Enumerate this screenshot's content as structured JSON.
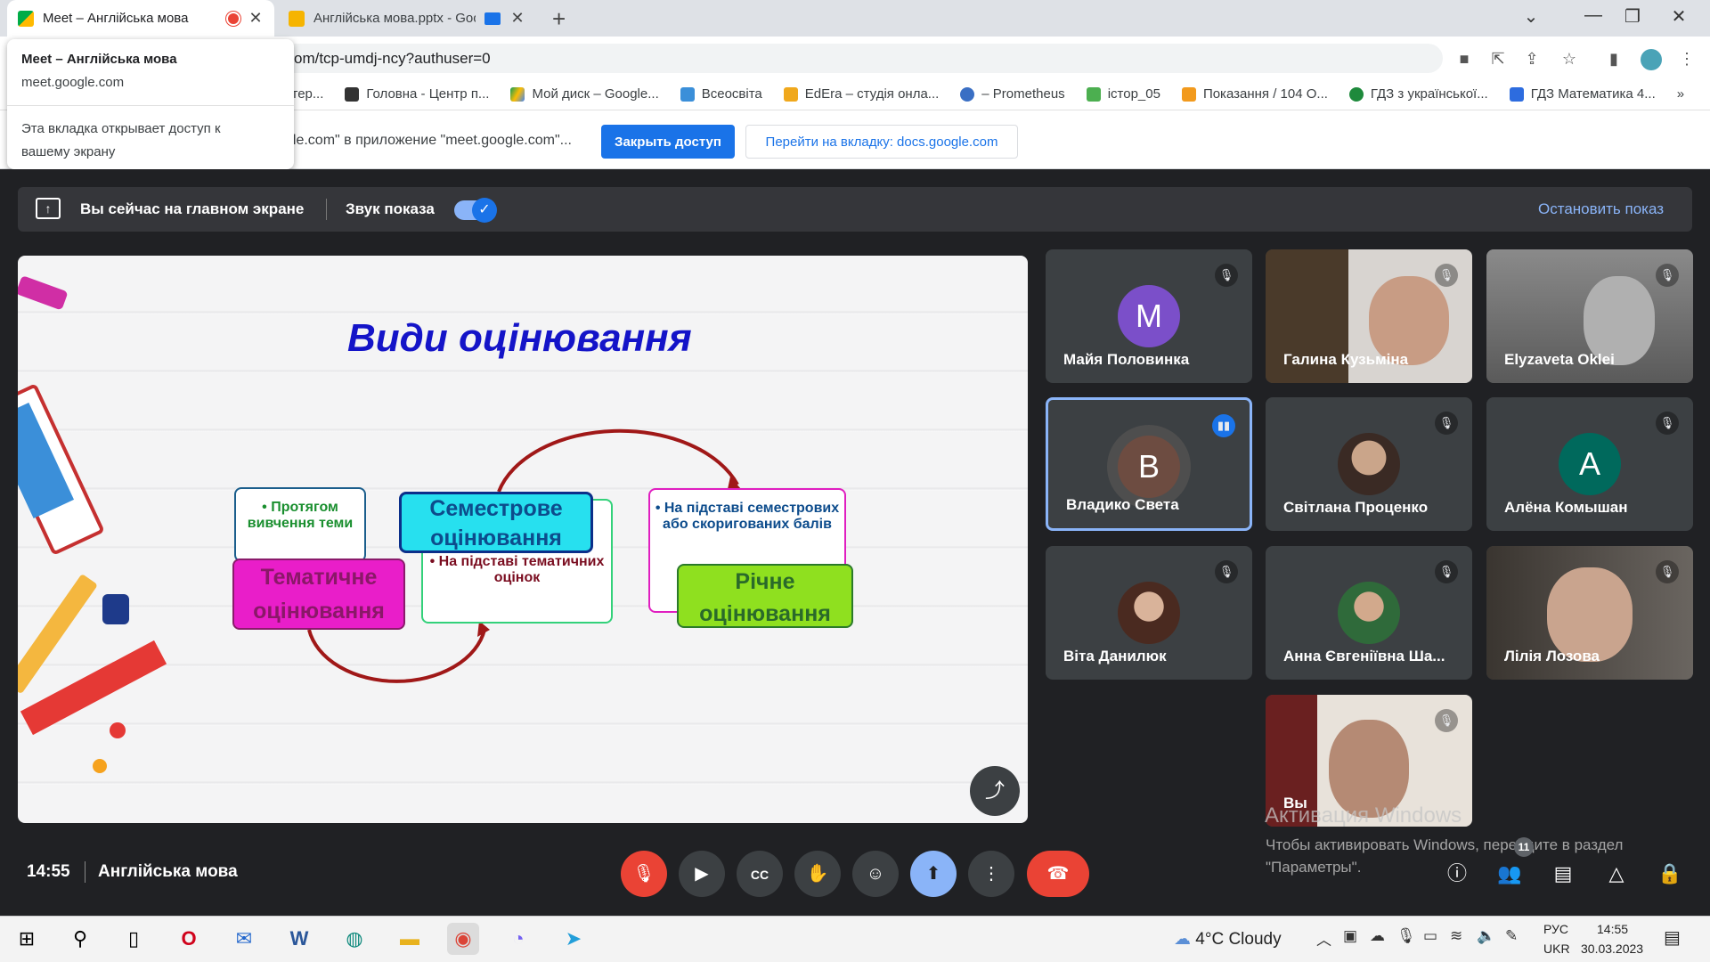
{
  "browser": {
    "tabs": [
      {
        "title": "Meet – Англійська мова"
      },
      {
        "title": "Англійська мова.pptx - Goo"
      }
    ],
    "url_visible": "om/tcp-umdj-ncy?authuser=0",
    "bookmarks": [
      {
        "label": "стер...",
        "icon": "bookmark-icon"
      },
      {
        "label": "Головна - Центр п...",
        "icon": "center-icon"
      },
      {
        "label": "Мой диск – Google...",
        "icon": "google-drive-icon"
      },
      {
        "label": "Всеосвіта",
        "icon": "snowflake-icon"
      },
      {
        "label": "EdEra – студія онла...",
        "icon": "edera-icon"
      },
      {
        "label": "– Prometheus",
        "icon": "pin-icon"
      },
      {
        "label": "істор_05",
        "icon": "board-icon"
      },
      {
        "label": "Показання / 104 О...",
        "icon": "table-icon"
      },
      {
        "label": "ГДЗ з української...",
        "icon": "gdz-icon"
      },
      {
        "label": "ГДЗ Математика 4...",
        "icon": "shield-icon"
      }
    ],
    "bookmarks_overflow": "»",
    "infobar": {
      "text": "gle.com\" в приложение \"meet.google.com\"...",
      "stop_label": "Закрыть доступ",
      "goto_label": "Перейти на вкладку: docs.google.com"
    },
    "hover_card": {
      "title": "Meet – Англійська мова",
      "url": "meet.google.com",
      "message": "Эта вкладка открывает доступ к вашему экрану"
    }
  },
  "meet": {
    "share_bar": {
      "status": "Вы сейчас на главном экране",
      "audio_label": "Звук показа",
      "stop_label": "Остановить показ"
    },
    "slide": {
      "title": "Види оцінювання",
      "box_a": "• Протягом вивчення теми",
      "box_b": "Тематичне оцінювання",
      "box_c": "• На підставі тематичних оцінок",
      "box_d": "Семестрове оцінювання",
      "box_e": "• На підставі семестрових або скоригованих балів",
      "box_f": "Річне оцінювання"
    },
    "participants": [
      {
        "name": "Майя Половинка",
        "letter": "M",
        "color": "#7b4fc9",
        "muted": true
      },
      {
        "name": "Галина Кузьміна",
        "muted": true
      },
      {
        "name": "Elyzaveta Oklei",
        "muted": true
      },
      {
        "name": "Владико Света",
        "letter": "B",
        "color": "#6d4c41",
        "speaking": true
      },
      {
        "name": "Світлана Проценко",
        "muted": true
      },
      {
        "name": "Алёна Комышан",
        "letter": "A",
        "color": "#00695c",
        "muted": true
      },
      {
        "name": "Віта Данилюк",
        "muted": true
      },
      {
        "name": "Анна Євгеніївна Ша...",
        "muted": true
      },
      {
        "name": "Лілія Лозова",
        "muted": true
      },
      {
        "name": "Вы",
        "muted": true
      }
    ],
    "watermark": {
      "title": "Активация Windows",
      "text": "Чтобы активировать Windows, перейдите в раздел \"Параметры\"."
    },
    "bottom": {
      "time": "14:55",
      "meeting_name": "Англійська мова",
      "participant_count": "11"
    }
  },
  "taskbar": {
    "weather": "4°C  Cloudy",
    "lang_top": "РУС",
    "lang_bottom": "UKR",
    "time": "14:55",
    "date": "30.03.2023"
  },
  "colors": {
    "accent": "#1a73e8",
    "meet_bg": "#202124",
    "end_call": "#ea4335",
    "active_tile_border": "#8ab4f8"
  }
}
